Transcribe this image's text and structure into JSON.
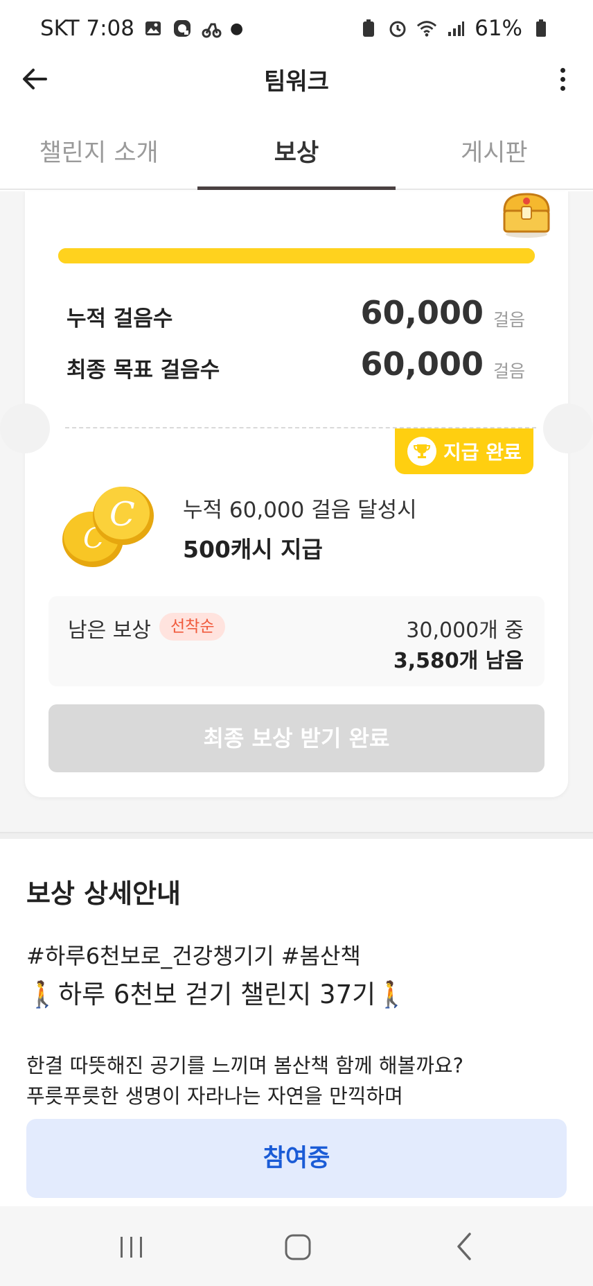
{
  "status_bar": {
    "carrier_time": "SKT 7:08",
    "battery": "61%"
  },
  "app_bar": {
    "title": "팀워크"
  },
  "tabs": [
    {
      "label": "챌린지 소개",
      "active": false
    },
    {
      "label": "보상",
      "active": true
    },
    {
      "label": "게시판",
      "active": false
    }
  ],
  "progress": {
    "fraction": 1.0,
    "color": "#ffd21e"
  },
  "steps": {
    "accumulated_label": "누적 걸음수",
    "accumulated_value": "60,000",
    "goal_label": "최종 목표 걸음수",
    "goal_value": "60,000",
    "unit": "걸음"
  },
  "badge": {
    "label": "지급 완료"
  },
  "reward": {
    "condition": "누적 60,000 걸음 달성시",
    "amount": "500캐시 지급"
  },
  "remaining": {
    "label": "남은 보상",
    "tag": "선착순",
    "total": "30,000개 중",
    "left": "3,580개 남음"
  },
  "final_button": {
    "label": "최종 보상 받기 완료"
  },
  "details": {
    "title": "보상 상세안내",
    "hashtags": "#하루6천보로_건강챙기기 #봄산책",
    "headline": "하루 6천보 걷기 챌린지 37기",
    "body_line1": "한결 따뜻해진 공기를 느끼며 봄산책 함께 해볼까요?",
    "body_line2": "푸릇푸릇한 생명이 자라나는 자연을 만끽하며"
  },
  "join_button": {
    "label": "참여중"
  },
  "colors": {
    "accent_yellow": "#ffcf10",
    "join_blue": "#1a5bd6",
    "tag_red": "#f05a3c"
  }
}
